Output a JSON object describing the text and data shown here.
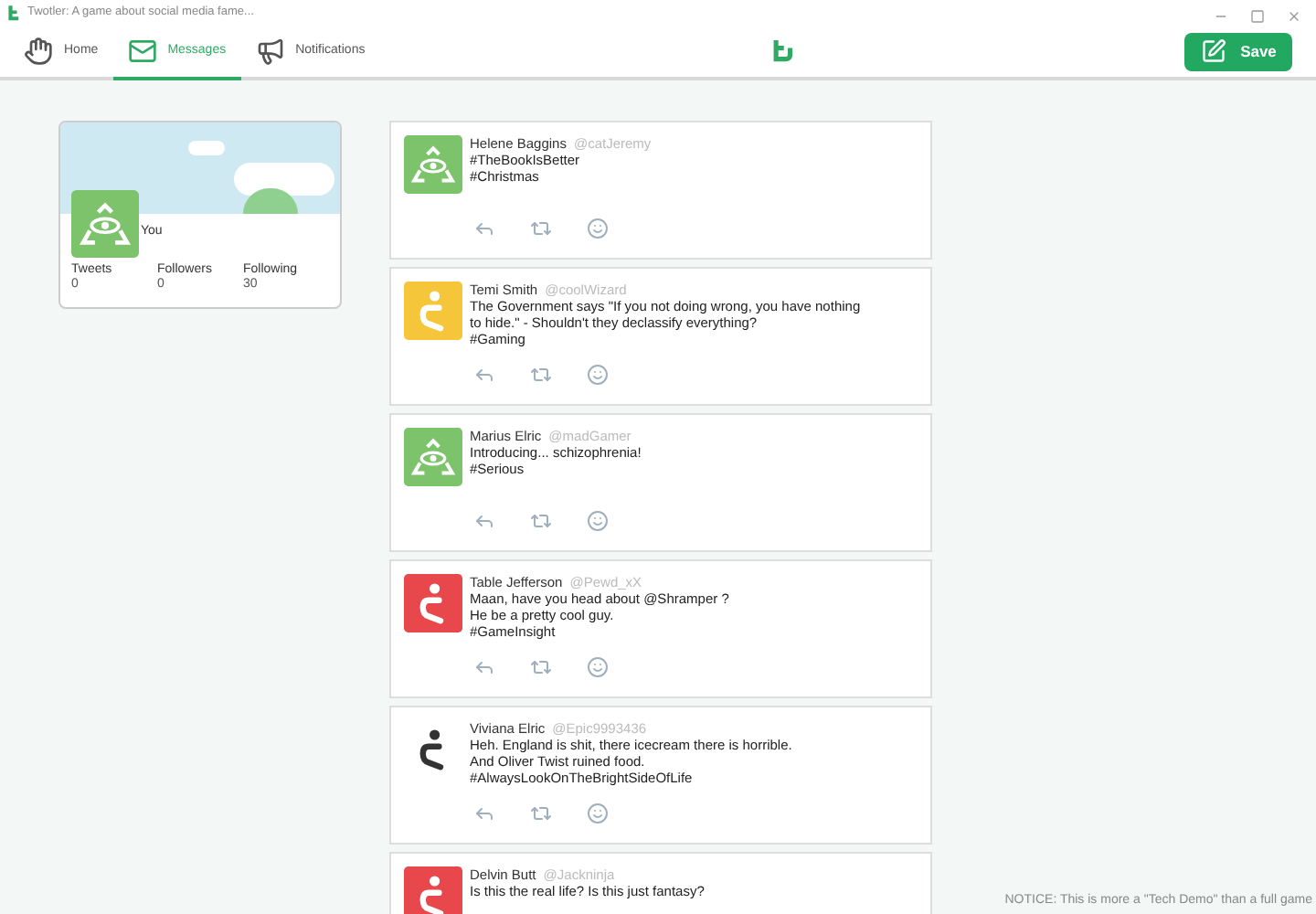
{
  "window": {
    "title": "Twotler: A game about social media fame..."
  },
  "tabs": [
    {
      "label": "Home",
      "selected": false
    },
    {
      "label": "Messages",
      "selected": true
    },
    {
      "label": "Notifications",
      "selected": false
    }
  ],
  "save_button": {
    "label": "Save"
  },
  "profile": {
    "name": "You",
    "avatar": {
      "kind": "eye",
      "color": "#7cc36c"
    },
    "stats": [
      {
        "label": "Tweets",
        "value": "0"
      },
      {
        "label": "Followers",
        "value": "0"
      },
      {
        "label": "Following",
        "value": "30"
      }
    ]
  },
  "posts": [
    {
      "name": "Helene Baggins",
      "handle": "@catJeremy",
      "avatar": {
        "kind": "eye",
        "color": "#7cc36c"
      },
      "lines": [
        "#TheBookIsBetter",
        "#Christmas"
      ]
    },
    {
      "name": "Temi Smith",
      "handle": "@coolWizard",
      "avatar": {
        "kind": "question",
        "color": "#f5c53a"
      },
      "lines": [
        "The Government says \"If you not doing wrong, you have nothing",
        "to hide.\" - Shouldn't they declassify everything?",
        "#Gaming"
      ]
    },
    {
      "name": "Marius Elric",
      "handle": "@madGamer",
      "avatar": {
        "kind": "eye",
        "color": "#7cc36c"
      },
      "lines": [
        "Introducing... schizophrenia!",
        "#Serious"
      ]
    },
    {
      "name": "Table Jefferson",
      "handle": "@Pewd_xX",
      "avatar": {
        "kind": "question",
        "color": "#e8474c"
      },
      "lines": [
        "Maan, have you head about @Shramper ?",
        "He be a pretty cool guy.",
        "#GameInsight"
      ]
    },
    {
      "name": "Viviana Elric",
      "handle": "@Epic9993436",
      "avatar": {
        "kind": "question-outline",
        "color": "#333333"
      },
      "lines": [
        "Heh. England is shit, there icecream there is horrible.",
        "And Oliver Twist ruined food.",
        "#AlwaysLookOnTheBrightSideOfLife"
      ]
    },
    {
      "name": "Delvin Butt",
      "handle": "@Jackninja",
      "avatar": {
        "kind": "question",
        "color": "#e8474c"
      },
      "lines": [
        "Is this the real life? Is this just fantasy?"
      ]
    }
  ],
  "notice": "NOTICE: This is more a \"Tech Demo\" than a full game"
}
